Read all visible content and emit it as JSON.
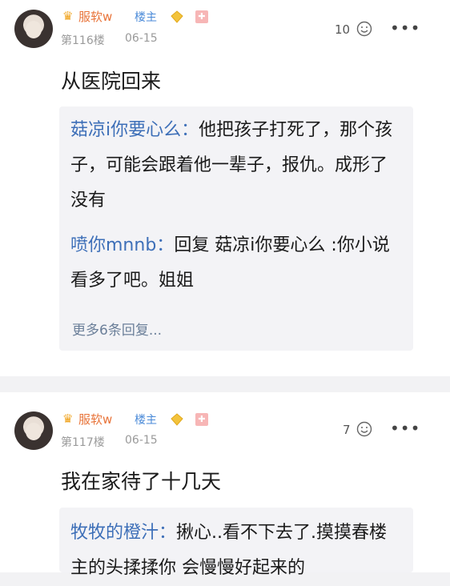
{
  "posts": [
    {
      "username": "服软w",
      "op_badge": "楼主",
      "floor": "第116楼",
      "date": "06-15",
      "likes": "10",
      "content": "从医院回来",
      "replies": [
        {
          "author": "菇凉i你要心么",
          "sep": "：",
          "text": "他把孩子打死了，那个孩子，可能会跟着他一辈子，报仇。成形了没有"
        },
        {
          "author": "喷你mnnb",
          "sep": "：",
          "text": "回复 菇凉i你要心么 :你小说看多了吧。姐姐"
        }
      ],
      "more_replies": "更多6条回复..."
    },
    {
      "username": "服软w",
      "op_badge": "楼主",
      "floor": "第117楼",
      "date": "06-15",
      "likes": "7",
      "content": "我在家待了十几天",
      "replies": [
        {
          "author": "牧牧的橙汁",
          "sep": "：",
          "text": "揪心..看不下去了.摸摸春楼主的头揉揉你 会慢慢好起来的"
        }
      ]
    }
  ],
  "icons": {
    "menu": "more-dots-icon",
    "like": "like-face-icon",
    "crown": "crown-icon",
    "diamond": "diamond-badge-icon",
    "level": "level-badge-icon"
  },
  "colors": {
    "username": "#e8743a",
    "op_badge": "#4a8ad8",
    "reply_author": "#3d6fb8",
    "reply_bg": "#f3f3f6"
  }
}
